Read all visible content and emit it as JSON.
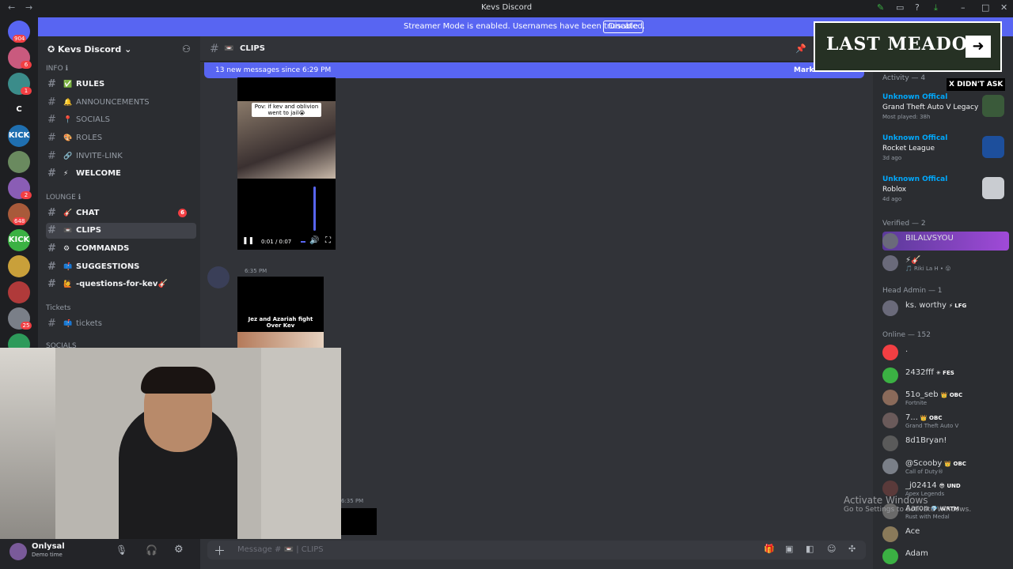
{
  "window": {
    "title": "Kevs Discord"
  },
  "banner": {
    "text": "Streamer Mode is enabled. Usernames have been truncated.",
    "button": "Disable"
  },
  "servers": [
    {
      "badge": "904",
      "color": "#5865f2"
    },
    {
      "badge": "6",
      "color": "#c95a7e"
    },
    {
      "badge": "1",
      "color": "#3b8c8a"
    },
    {
      "label": "C",
      "color": "#1e1f22"
    },
    {
      "label": "KICK",
      "color": "#1f6fb0"
    },
    {
      "badge": "",
      "color": "#6a8a5f"
    },
    {
      "badge": "2",
      "color": "#8a5db5"
    },
    {
      "badge": "648",
      "color": "#a85a3a"
    },
    {
      "label": "KICK",
      "color": "#3bb143"
    },
    {
      "badge": "",
      "color": "#c9a03a"
    },
    {
      "badge": "",
      "color": "#b03a3a"
    },
    {
      "badge": "25",
      "color": "#7a7f88"
    },
    {
      "badge": "",
      "color": "#2d9a5a"
    }
  ],
  "guild": {
    "name": "Kevs Discord"
  },
  "categories": {
    "info": "INFO ℹ",
    "lounge": "LOUNGE ℹ",
    "tickets": "Tickets",
    "socials": "SOCIALS"
  },
  "channels": [
    {
      "name": "RULES",
      "emoji": "✅",
      "bold": true
    },
    {
      "name": "ANNOUNCEMENTS",
      "emoji": "🔔",
      "bold": false
    },
    {
      "name": "SOCIALS",
      "emoji": "📍",
      "bold": false
    },
    {
      "name": "ROLES",
      "emoji": "🎨",
      "bold": false
    },
    {
      "name": "INVITE-LINK",
      "emoji": "🔗",
      "bold": false
    },
    {
      "name": "WELCOME",
      "emoji": "⚡",
      "bold": true
    },
    {
      "name": "CHAT",
      "emoji": "🎸",
      "bold": true,
      "badge": "6"
    },
    {
      "name": "CLIPS",
      "emoji": "📼",
      "bold": true,
      "selected": true
    },
    {
      "name": "COMMANDS",
      "emoji": "⚙",
      "bold": true
    },
    {
      "name": "SUGGESTIONS",
      "emoji": "📫",
      "bold": true
    },
    {
      "name": "-questions-for-kev🎸",
      "emoji": "🙋",
      "bold": true
    },
    {
      "name": "tickets",
      "emoji": "📫",
      "bold": false
    }
  ],
  "header": {
    "channel": "CLIPS",
    "channel_emoji": "📼"
  },
  "new_messages": {
    "text": "13 new messages since 6:29 PM",
    "action": "Mark As Read"
  },
  "video1": {
    "caption": "Pov: if kev and oblivion went to jail😭",
    "time": "0:01 / 0:07",
    "progress": 0.14
  },
  "message2": {
    "timestamp": "6:35 PM",
    "video_caption": "Jez and Azariah fight Over Kev"
  },
  "message3": {
    "timestamp": "6:35 PM"
  },
  "composer": {
    "placeholder": "Message # 📼 | CLIPS"
  },
  "user": {
    "name": "Onlysal",
    "status": "Demo time"
  },
  "overlay": {
    "title": "LAST MEADOW",
    "badge": "X DIDN'T ASK"
  },
  "members": {
    "activity_header": "Activity — 4",
    "activities": [
      {
        "who": "Unknown Offical",
        "game": "Grand Theft Auto V Legacy",
        "when": "Most played: 38h",
        "color": "#3a5a3a"
      },
      {
        "who": "Unknown Offical",
        "game": "Rocket League",
        "when": "3d ago",
        "color": "#1d4f9c"
      },
      {
        "who": "Unknown Offical",
        "game": "Roblox",
        "when": "4d ago",
        "color": "#c9ccd1"
      }
    ],
    "verified_header": "Verified — 2",
    "verified": [
      {
        "name": "BILALVSYOU",
        "sub": "",
        "highlight": true
      },
      {
        "name": "⚡🎸",
        "sub": "🎵 Riki La H • 😮",
        "highlight": false
      }
    ],
    "headadmin_header": "Head Admin — 1",
    "headadmin": [
      {
        "name": "ks. worthy",
        "tag": "⚡ LFG",
        "sub": ""
      }
    ],
    "online_header": "Online — 152",
    "online": [
      {
        "name": ".",
        "tag": "",
        "sub": "",
        "color": "#f23f43"
      },
      {
        "name": "2432fff",
        "tag": "✳ FES",
        "sub": "",
        "color": "#3bb143"
      },
      {
        "name": "51o_seb",
        "tag": "👑 OBC",
        "sub": "Fortnite",
        "color": "#8a6a5a"
      },
      {
        "name": "7...",
        "tag": "👑 OBC",
        "sub": "Grand Theft Auto V",
        "color": "#6a5a5a"
      },
      {
        "name": "8d1Bryan!",
        "tag": "",
        "sub": "",
        "color": "#5a5a5a"
      },
      {
        "name": "@Scooby",
        "tag": "👑 OBC",
        "sub": "Call of Duty®",
        "color": "#7a7f88"
      },
      {
        "name": "_j02414",
        "tag": "😎 UND",
        "sub": "Apex Legends",
        "color": "#5a3a3a"
      },
      {
        "name": "Aaron",
        "tag": "💎 WRTM",
        "sub": "Rust with Medal",
        "color": "#6a6a6a"
      },
      {
        "name": "Ace",
        "tag": "",
        "sub": "",
        "color": "#8a7a5a"
      },
      {
        "name": "Adam",
        "tag": "",
        "sub": "",
        "color": "#3bb143"
      }
    ]
  },
  "watermark": {
    "line1": "Activate Windows",
    "line2": "Go to Settings to activate Windows."
  }
}
